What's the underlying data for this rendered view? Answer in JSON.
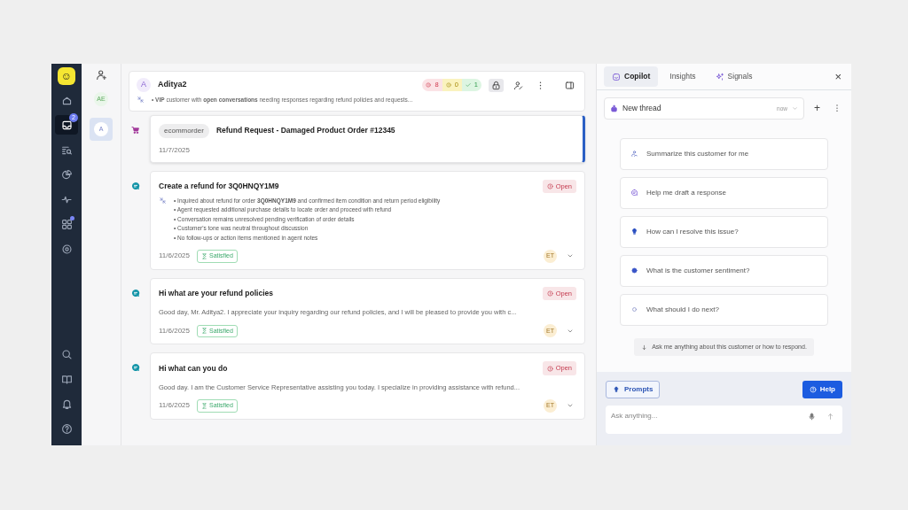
{
  "rail": {
    "logo": "☺",
    "top": [
      {
        "selected": false
      },
      {
        "selected": true,
        "badge": "2"
      },
      {
        "selected": false
      },
      {
        "selected": false
      },
      {
        "selected": false
      },
      {
        "selected": false,
        "dot": true
      },
      {
        "selected": false
      }
    ],
    "bottom": [
      {
        "selected": false
      },
      {
        "selected": false
      },
      {
        "selected": false
      },
      {
        "selected": false
      }
    ]
  },
  "contacts": [
    {
      "initials": "AE",
      "selected": false
    },
    {
      "initials": "A",
      "selected": true
    }
  ],
  "customer": {
    "initial": "A",
    "name": "Aditya2",
    "counts": [
      {
        "kind": "error",
        "text": "8"
      },
      {
        "kind": "warn",
        "text": "0"
      },
      {
        "kind": "ok",
        "text": "1"
      }
    ],
    "summary": "• **VIP** customer with **open conversations** needing responses regarding refund policies and requests..."
  },
  "timeline": [
    {
      "kind": "order",
      "selected": true,
      "tag": "ecommorder",
      "title": "Refund Request - Damaged Product Order #12345",
      "date": "11/7/2025"
    },
    {
      "kind": "conversation",
      "selected": false,
      "title": "Create a refund for 3Q0HNQY1M9",
      "status": "Open",
      "bullets": [
        "• Inquired about refund for order **3Q0HNQY1M9** and confirmed item condition and return period eligibility",
        "• Agent requested additional purchase details to locate order and proceed with refund",
        "• Conversation remains unresolved pending verification of order details",
        "• Customer's tone was neutral throughout discussion",
        "• No follow-ups or action items mentioned in agent notes"
      ],
      "date": "11/6/2025",
      "sentiment": "Satisfied",
      "agent": "ET"
    },
    {
      "kind": "conversation",
      "selected": false,
      "title": "Hi what are your refund policies",
      "status": "Open",
      "preview": "Good day, Mr. Aditya2. I appreciate your inquiry regarding our refund policies, and I will be pleased to provide you with c...",
      "date": "11/6/2025",
      "sentiment": "Satisfied",
      "agent": "ET"
    },
    {
      "kind": "conversation",
      "selected": false,
      "title": "Hi what can you do",
      "status": "Open",
      "preview": "Good day. I am the Customer Service Representative assisting you today. I specialize in providing assistance with refund...",
      "date": "11/6/2025",
      "sentiment": "Satisfied",
      "agent": "ET"
    }
  ],
  "copilot": {
    "tabs": [
      {
        "label": "Copilot",
        "selected": true
      },
      {
        "label": "Insights",
        "selected": false
      },
      {
        "label": "Signals",
        "selected": false
      }
    ],
    "close": "×",
    "thread": {
      "title": "New thread",
      "time": "now"
    },
    "add": "+",
    "suggestions": [
      {
        "text": "Summarize this customer for me"
      },
      {
        "text": "Help me draft a response"
      },
      {
        "text": "How can I resolve this issue?"
      },
      {
        "text": "What is the customer sentiment?"
      },
      {
        "text": "What should I do next?"
      }
    ],
    "hint": "Ask me anything about this customer or how to respond.",
    "prompts": "Prompts",
    "help": "Help",
    "input": {
      "placeholder": "Ask anything..."
    }
  }
}
